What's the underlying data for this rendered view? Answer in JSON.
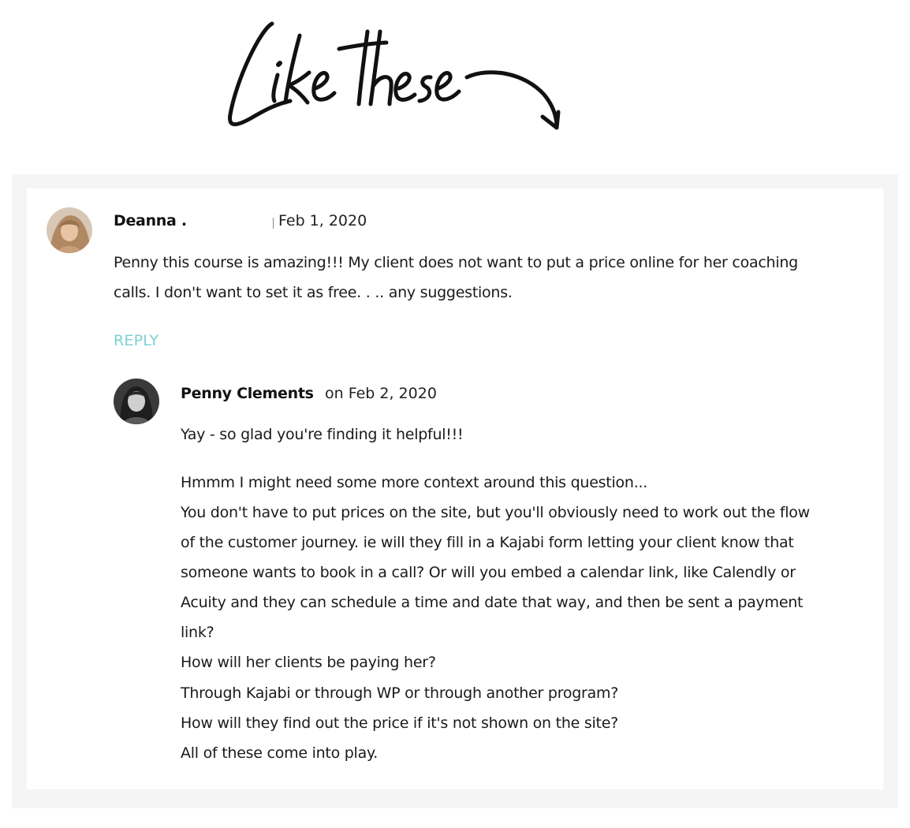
{
  "header": {
    "script_title": "Like these"
  },
  "comment": {
    "author": "Deanna .",
    "date": "Feb 1, 2020",
    "lines": [
      "Penny this course is amazing!!! My client does not want to put a price online for her coaching",
      "calls. I don't want to set it as free. . .. any suggestions."
    ],
    "reply_label": "REPLY"
  },
  "reply": {
    "author": "Penny Clements",
    "date": "on Feb 2, 2020",
    "intro": "Yay - so glad you're finding it helpful!!!",
    "lines": [
      "Hmmm I might need some more context around this question...",
      "You don't have to put prices on the site, but you'll obviously need to work out the flow",
      "of the customer journey. ie will they fill in a Kajabi form letting your client know that",
      "someone wants to book in a call? Or will you embed a calendar link, like Calendly or",
      "Acuity and they can schedule a time and date that way, and then be sent a payment",
      "link?",
      "How will her clients be paying her?",
      "Through Kajabi or through WP or through another program?",
      "How will they find out the price if it's not shown on the site?",
      "All of these come into play."
    ]
  }
}
